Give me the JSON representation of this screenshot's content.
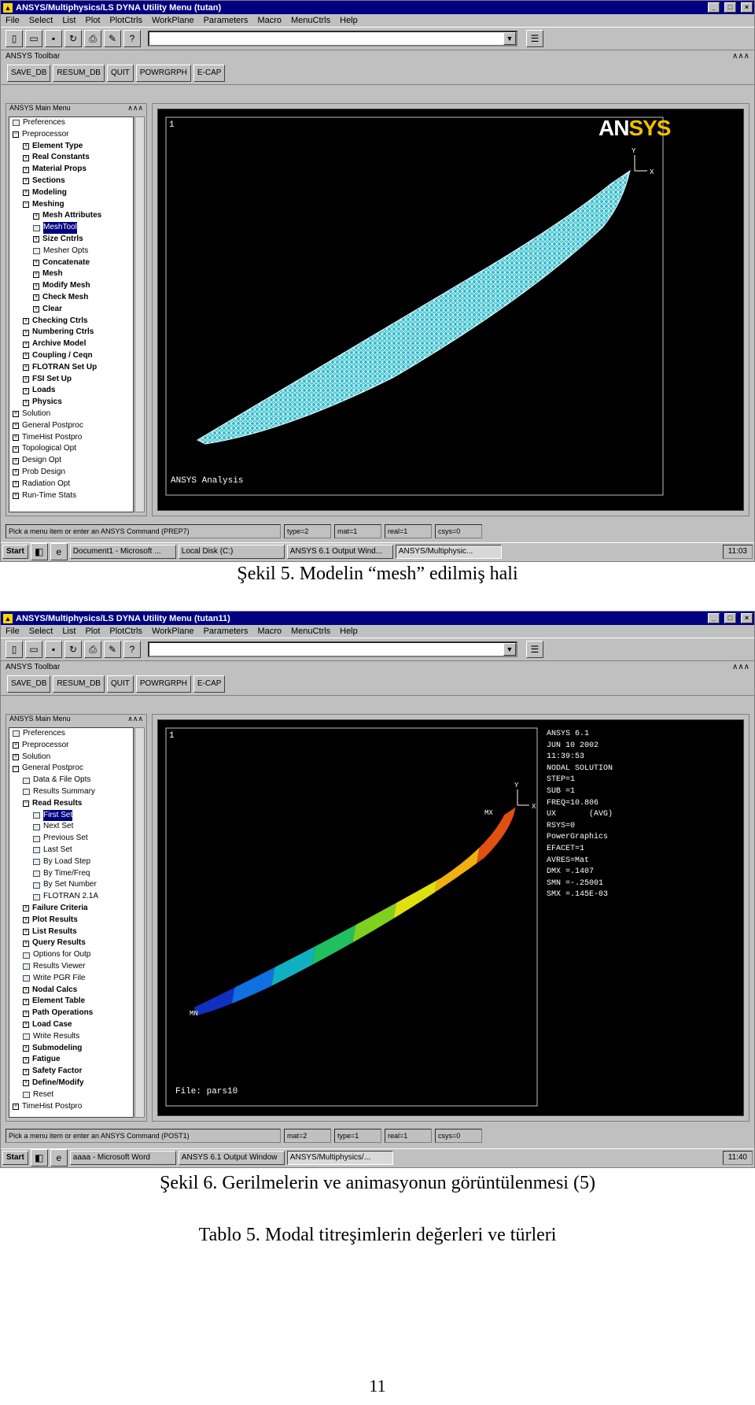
{
  "figure1": {
    "window_title": "ANSYS/Multiphysics/LS DYNA Utility Menu (tutan)",
    "menu": [
      "File",
      "Select",
      "List",
      "Plot",
      "PlotCtrls",
      "WorkPlane",
      "Parameters",
      "Macro",
      "MenuCtrls",
      "Help"
    ],
    "toolbar_title": "ANSYS Toolbar",
    "toolbar_buttons": [
      "SAVE_DB",
      "RESUM_DB",
      "QUIT",
      "POWRGRPH",
      "E-CAP"
    ],
    "main_menu_title": "ANSYS Main Menu",
    "tree": [
      {
        "label": "Preferences",
        "level": 0,
        "icon": "file"
      },
      {
        "label": "Preprocessor",
        "level": 0,
        "icon": "minus"
      },
      {
        "label": "Element Type",
        "level": 1,
        "icon": "plus"
      },
      {
        "label": "Real Constants",
        "level": 1,
        "icon": "plus"
      },
      {
        "label": "Material Props",
        "level": 1,
        "icon": "plus"
      },
      {
        "label": "Sections",
        "level": 1,
        "icon": "plus"
      },
      {
        "label": "Modeling",
        "level": 1,
        "icon": "plus"
      },
      {
        "label": "Meshing",
        "level": 1,
        "icon": "minus"
      },
      {
        "label": "Mesh Attributes",
        "level": 2,
        "icon": "plus"
      },
      {
        "label": "MeshTool",
        "level": 2,
        "icon": "file",
        "selected": true
      },
      {
        "label": "Size Cntrls",
        "level": 2,
        "icon": "plus"
      },
      {
        "label": "Mesher Opts",
        "level": 2,
        "icon": "file"
      },
      {
        "label": "Concatenate",
        "level": 2,
        "icon": "plus"
      },
      {
        "label": "Mesh",
        "level": 2,
        "icon": "plus"
      },
      {
        "label": "Modify Mesh",
        "level": 2,
        "icon": "plus"
      },
      {
        "label": "Check Mesh",
        "level": 2,
        "icon": "plus"
      },
      {
        "label": "Clear",
        "level": 2,
        "icon": "plus"
      },
      {
        "label": "Checking Ctrls",
        "level": 1,
        "icon": "plus"
      },
      {
        "label": "Numbering Ctrls",
        "level": 1,
        "icon": "plus"
      },
      {
        "label": "Archive Model",
        "level": 1,
        "icon": "plus"
      },
      {
        "label": "Coupling / Ceqn",
        "level": 1,
        "icon": "plus"
      },
      {
        "label": "FLOTRAN Set Up",
        "level": 1,
        "icon": "plus"
      },
      {
        "label": "FSI Set Up",
        "level": 1,
        "icon": "plus"
      },
      {
        "label": "Loads",
        "level": 1,
        "icon": "plus"
      },
      {
        "label": "Physics",
        "level": 1,
        "icon": "plus"
      },
      {
        "label": "Solution",
        "level": 0,
        "icon": "plus"
      },
      {
        "label": "General Postproc",
        "level": 0,
        "icon": "plus"
      },
      {
        "label": "TimeHist Postpro",
        "level": 0,
        "icon": "plus"
      },
      {
        "label": "Topological Opt",
        "level": 0,
        "icon": "plus"
      },
      {
        "label": "Design Opt",
        "level": 0,
        "icon": "plus"
      },
      {
        "label": "Prob Design",
        "level": 0,
        "icon": "plus"
      },
      {
        "label": "Radiation Opt",
        "level": 0,
        "icon": "plus"
      },
      {
        "label": "Run-Time Stats",
        "level": 0,
        "icon": "plus"
      }
    ],
    "window_number": "1",
    "logo": "ANSYS",
    "graphics_footer": "ANSYS Analysis",
    "status": [
      "Pick a menu item or enter an ANSYS Command (PREP7)",
      "type=2",
      "mat=1",
      "real=1",
      "csys=0"
    ],
    "taskbar": {
      "start": "Start",
      "items": [
        "Document1 - Microsoft ...",
        "Local Disk (C:)",
        "ANSYS 6.1 Output Wind...",
        "ANSYS/Multiphysic..."
      ],
      "clock": "11:03"
    },
    "caption": "Şekil 5. Modelin “mesh” edilmiş hali"
  },
  "figure2": {
    "window_title": "ANSYS/Multiphysics/LS DYNA Utility Menu (tutan11)",
    "menu": [
      "File",
      "Select",
      "List",
      "Plot",
      "PlotCtrls",
      "WorkPlane",
      "Parameters",
      "Macro",
      "MenuCtrls",
      "Help"
    ],
    "toolbar_title": "ANSYS Toolbar",
    "toolbar_buttons": [
      "SAVE_DB",
      "RESUM_DB",
      "QUIT",
      "POWRGRPH",
      "E-CAP"
    ],
    "main_menu_title": "ANSYS Main Menu",
    "tree": [
      {
        "label": "Preferences",
        "level": 0,
        "icon": "file"
      },
      {
        "label": "Preprocessor",
        "level": 0,
        "icon": "plus"
      },
      {
        "label": "Solution",
        "level": 0,
        "icon": "plus"
      },
      {
        "label": "General Postproc",
        "level": 0,
        "icon": "minus"
      },
      {
        "label": "Data & File Opts",
        "level": 1,
        "icon": "file"
      },
      {
        "label": "Results Summary",
        "level": 1,
        "icon": "file"
      },
      {
        "label": "Read Results",
        "level": 1,
        "icon": "minus"
      },
      {
        "label": "First Set",
        "level": 2,
        "icon": "file",
        "selected": true
      },
      {
        "label": "Next Set",
        "level": 2,
        "icon": "file"
      },
      {
        "label": "Previous Set",
        "level": 2,
        "icon": "file"
      },
      {
        "label": "Last Set",
        "level": 2,
        "icon": "file"
      },
      {
        "label": "By Load Step",
        "level": 2,
        "icon": "file"
      },
      {
        "label": "By Time/Freq",
        "level": 2,
        "icon": "file"
      },
      {
        "label": "By Set Number",
        "level": 2,
        "icon": "file"
      },
      {
        "label": "FLOTRAN 2.1A",
        "level": 2,
        "icon": "file"
      },
      {
        "label": "Failure Criteria",
        "level": 1,
        "icon": "plus"
      },
      {
        "label": "Plot Results",
        "level": 1,
        "icon": "plus"
      },
      {
        "label": "List Results",
        "level": 1,
        "icon": "plus"
      },
      {
        "label": "Query Results",
        "level": 1,
        "icon": "plus"
      },
      {
        "label": "Options for Outp",
        "level": 1,
        "icon": "file"
      },
      {
        "label": "Results Viewer",
        "level": 1,
        "icon": "file"
      },
      {
        "label": "Write PGR File",
        "level": 1,
        "icon": "file"
      },
      {
        "label": "Nodal Calcs",
        "level": 1,
        "icon": "plus"
      },
      {
        "label": "Element Table",
        "level": 1,
        "icon": "plus"
      },
      {
        "label": "Path Operations",
        "level": 1,
        "icon": "plus"
      },
      {
        "label": "Load Case",
        "level": 1,
        "icon": "plus"
      },
      {
        "label": "Write Results",
        "level": 1,
        "icon": "file"
      },
      {
        "label": "Submodeling",
        "level": 1,
        "icon": "plus"
      },
      {
        "label": "Fatigue",
        "level": 1,
        "icon": "plus"
      },
      {
        "label": "Safety Factor",
        "level": 1,
        "icon": "plus"
      },
      {
        "label": "Define/Modify",
        "level": 1,
        "icon": "plus"
      },
      {
        "label": "Reset",
        "level": 1,
        "icon": "file"
      },
      {
        "label": "TimeHist Postpro",
        "level": 0,
        "icon": "plus"
      }
    ],
    "window_number": "1",
    "info_lines": [
      "ANSYS 6.1",
      "JUN 10 2002",
      "11:39:53",
      "NODAL SOLUTION",
      "STEP=1",
      "SUB =1",
      "FREQ=10.806",
      "UX       (AVG)",
      "RSYS=0",
      "PowerGraphics",
      "EFACET=1",
      "AVRES=Mat",
      "DMX =.1407",
      "SMN =-.25001",
      "SMX =.145E-03"
    ],
    "label_mx": "MX",
    "label_mn": "MN",
    "graphics_footer": "File: pars10",
    "status": [
      "Pick a menu item or enter an ANSYS Command (POST1)",
      "mat=2",
      "type=1",
      "real=1",
      "csys=0"
    ],
    "taskbar": {
      "start": "Start",
      "items": [
        "aaaa - Microsoft Word",
        "ANSYS 6.1 Output Window",
        "ANSYS/Multiphysics/..."
      ],
      "clock": "11:40"
    },
    "caption": "Şekil 6. Gerilmelerin ve animasyonun görüntülenmesi (5)"
  },
  "table_caption": "Tablo 5. Modal titreşimlerin değerleri ve türleri",
  "page_number": "11",
  "colors": {
    "title_blue": "#000080",
    "mesh_cyan": "#4fd8e0",
    "contour": [
      "#1030c0",
      "#1070e0",
      "#10b0c0",
      "#20c060",
      "#80d020",
      "#e0e010",
      "#f0b010",
      "#e05010",
      "#d01010"
    ]
  }
}
